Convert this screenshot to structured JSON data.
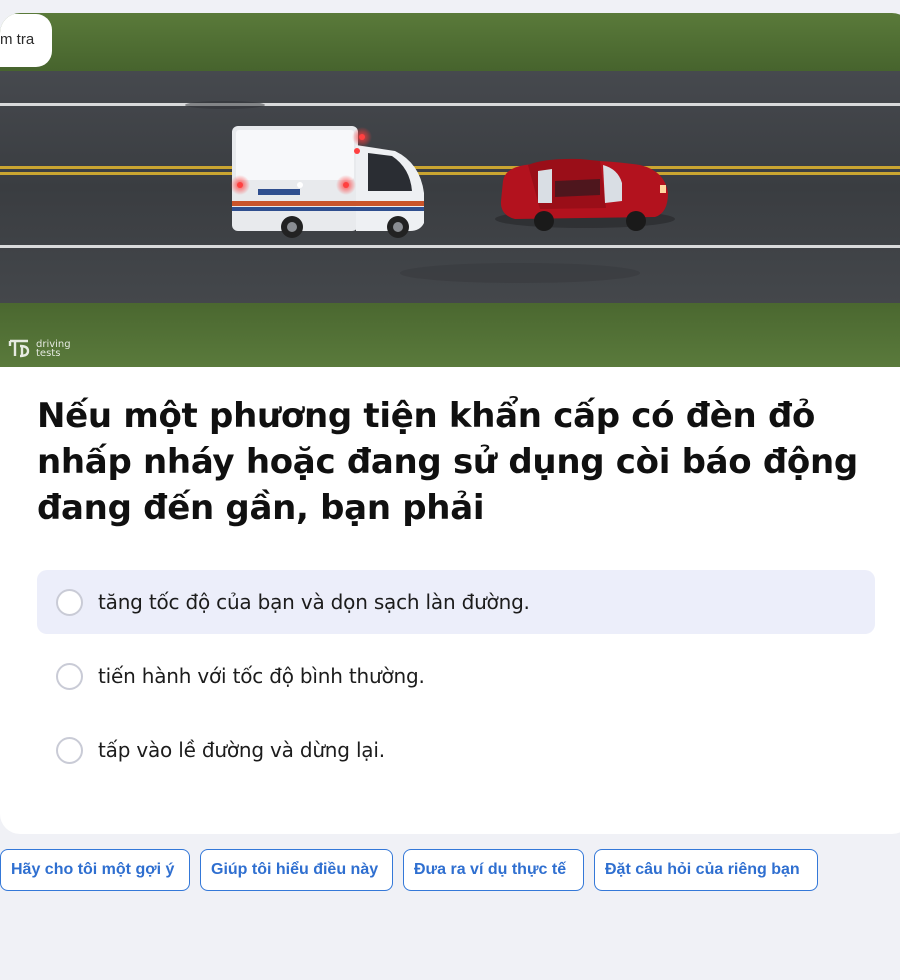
{
  "card": {
    "tag_label": "m tra",
    "watermark_text_line1": "driving",
    "watermark_text_line2": "tests"
  },
  "question": {
    "text": "Nếu một phương tiện khẩn cấp có đèn đỏ nhấp nháy hoặc đang sử dụng còi báo động đang đến gần, bạn phải"
  },
  "answers": [
    {
      "label": "tăng tốc độ của bạn và dọn sạch làn đường.",
      "state": "hovered"
    },
    {
      "label": "tiến hành với tốc độ bình thường.",
      "state": "default"
    },
    {
      "label": "tấp vào lề đường và dừng lại.",
      "state": "default"
    }
  ],
  "suggestions": [
    {
      "label": "Hãy cho tôi một gợi ý"
    },
    {
      "label": "Giúp tôi hiểu điều này"
    },
    {
      "label": "Đưa ra ví dụ thực tế"
    },
    {
      "label": "Đặt câu hỏi của riêng bạn"
    }
  ],
  "colors": {
    "page_bg": "#f0f1f6",
    "accent_blue": "#2f6fd0",
    "hover_bg": "#eceefa",
    "grass": "#4d6b33",
    "asphalt": "#3d4044",
    "car_red": "#b3121e"
  }
}
